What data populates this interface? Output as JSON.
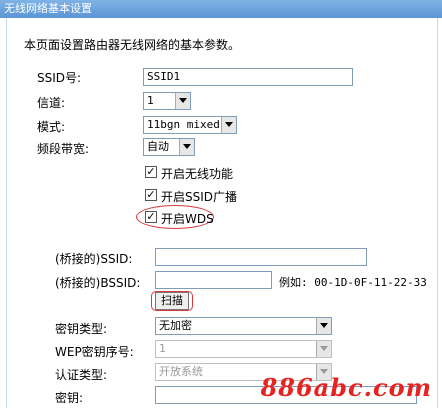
{
  "window": {
    "title": "无线网络基本设置"
  },
  "description": "本页面设置路由器无线网络的基本参数。",
  "fields": {
    "ssid": {
      "label": "SSID号:",
      "value": "SSID1"
    },
    "channel": {
      "label": "信道:",
      "value": "1"
    },
    "mode": {
      "label": "模式:",
      "value": "11bgn mixed"
    },
    "bandwidth": {
      "label": "频段带宽:",
      "value": "自动"
    }
  },
  "checks": {
    "enable_wireless": {
      "label": "开启无线功能",
      "checked": true
    },
    "ssid_broadcast": {
      "label": "开启SSID广播",
      "checked": true
    },
    "wds": {
      "label": "开启WDS",
      "checked": true
    }
  },
  "bridge": {
    "ssid_label": "(桥接的)SSID:",
    "ssid_value": "",
    "bssid_label": "(桥接的)BSSID:",
    "bssid_value": "",
    "example": "例如: 00-1D-0F-11-22-33",
    "scan_button": "扫描"
  },
  "security": {
    "key_type_label": "密钥类型:",
    "key_type_value": "无加密",
    "wep_index_label": "WEP密钥序号:",
    "wep_index_value": "1",
    "auth_label": "认证类型:",
    "auth_value": "开放系统",
    "key_label": "密钥:",
    "key_value": ""
  },
  "watermark": "886abc.com",
  "colors": {
    "highlight": "#d93a3a",
    "watermark": "#e8231f",
    "titlebar": "#5b95d6"
  }
}
